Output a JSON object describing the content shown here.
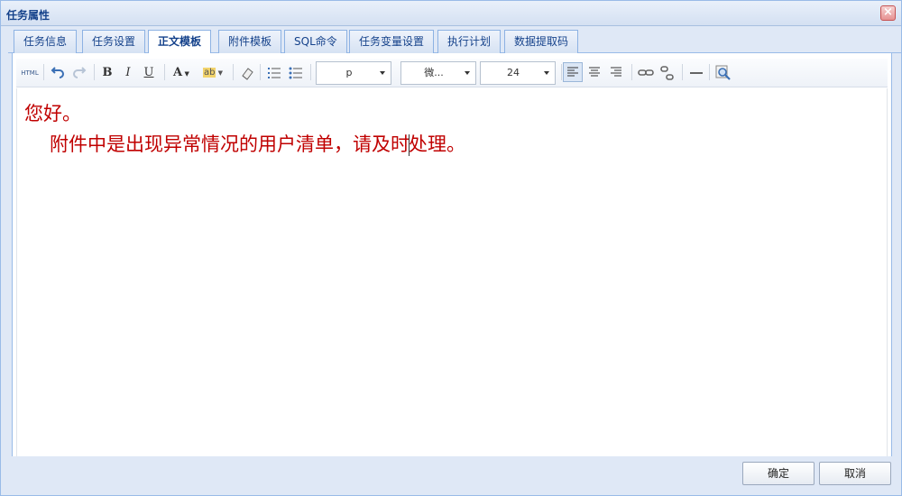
{
  "window": {
    "title": "任务属性"
  },
  "tabs": [
    {
      "label": "任务信息"
    },
    {
      "label": "任务设置"
    },
    {
      "label": "正文模板",
      "active": true
    },
    {
      "label": "附件模板"
    },
    {
      "label": "SQL命令"
    },
    {
      "label": "任务变量设置"
    },
    {
      "label": "执行计划"
    },
    {
      "label": "数据提取码"
    }
  ],
  "toolbar": {
    "html_label": "HTML",
    "bold_label": "B",
    "italic_label": "I",
    "underline_label": "U",
    "font_color_label": "A",
    "highlight_label": "ab",
    "paragraph_select": "p",
    "font_select": "微...",
    "size_select": "24",
    "active_alignment": "left"
  },
  "editor": {
    "line1": "您好。",
    "line2_before_caret": "附件中是出现异常情况的用户清单，请及时",
    "line2_after_caret": "处理。",
    "text_color": "#c00000"
  },
  "footer": {
    "ok_label": "确定",
    "cancel_label": "取消"
  },
  "colors": {
    "title_text": "#15428b",
    "border": "#99bbe8",
    "background": "#dfe8f6"
  }
}
